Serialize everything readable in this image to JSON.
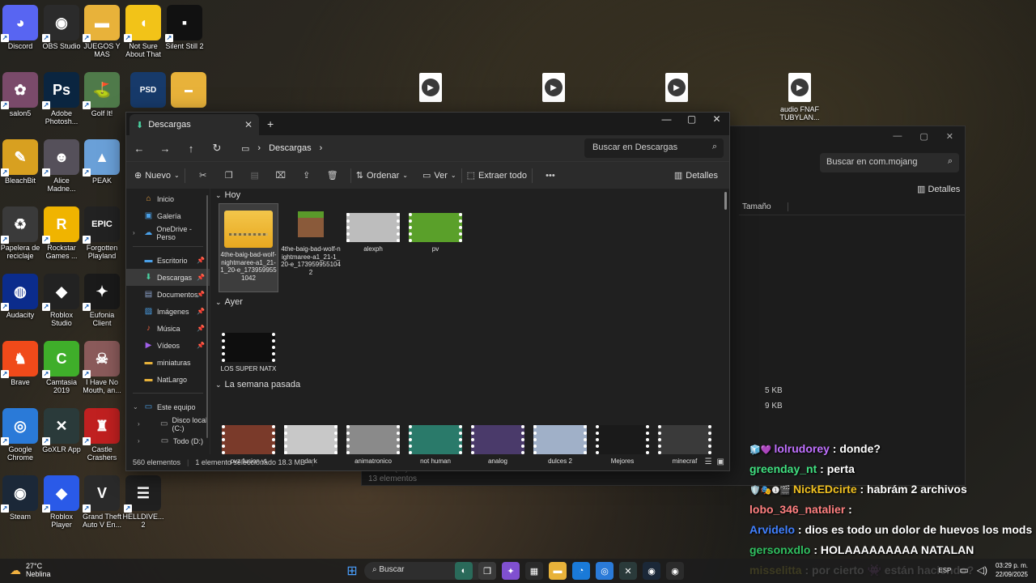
{
  "desktop": {
    "icons": [
      {
        "label": "Discord",
        "color": "#5865F2",
        "glyph": "◕",
        "col": 0,
        "row": 0
      },
      {
        "label": "OBS Studio",
        "color": "#2b2b2b",
        "glyph": "◉",
        "col": 1,
        "row": 0
      },
      {
        "label": "JUEGOS Y MAS",
        "color": "#e8b23a",
        "glyph": "▬",
        "col": 2,
        "row": 0
      },
      {
        "label": "Not Sure About That",
        "color": "#f2c318",
        "glyph": "◖",
        "col": 3,
        "row": 0
      },
      {
        "label": "Silent Still 2",
        "color": "#111111",
        "glyph": "▪",
        "col": 4,
        "row": 0
      },
      {
        "label": "salon5",
        "color": "#7a4a6a",
        "glyph": "✿",
        "col": 0,
        "row": 1
      },
      {
        "label": "Adobe Photosh...",
        "color": "#0a2540",
        "glyph": "Ps",
        "col": 1,
        "row": 1
      },
      {
        "label": "Golf It!",
        "color": "#4f7a4a",
        "glyph": "⛳",
        "col": 2,
        "row": 1
      },
      {
        "label": "BleachBit",
        "color": "#d8a020",
        "glyph": "✎",
        "col": 0,
        "row": 2
      },
      {
        "label": "Alice Madne...",
        "color": "#55505a",
        "glyph": "☻",
        "col": 1,
        "row": 2
      },
      {
        "label": "PEAK",
        "color": "#6aa0d8",
        "glyph": "▲",
        "col": 2,
        "row": 2
      },
      {
        "label": "Papelera de reciclaje",
        "color": "#3a3a3a",
        "glyph": "♻",
        "col": 0,
        "row": 3
      },
      {
        "label": "Rockstar Games ...",
        "color": "#f0b400",
        "glyph": "R",
        "col": 1,
        "row": 3
      },
      {
        "label": "Forgotten Playland",
        "color": "#222222",
        "glyph": "EPIC",
        "col": 2,
        "row": 3
      },
      {
        "label": "Audacity",
        "color": "#0b2c8c",
        "glyph": "◍",
        "col": 0,
        "row": 4
      },
      {
        "label": "Roblox Studio",
        "color": "#222222",
        "glyph": "◆",
        "col": 1,
        "row": 4
      },
      {
        "label": "Eufonia Client",
        "color": "#1a1a1a",
        "glyph": "✦",
        "col": 2,
        "row": 4
      },
      {
        "label": "Brave",
        "color": "#f04a1a",
        "glyph": "♞",
        "col": 0,
        "row": 5
      },
      {
        "label": "Camtasia 2019",
        "color": "#3fae2a",
        "glyph": "C",
        "col": 1,
        "row": 5
      },
      {
        "label": "I Have No Mouth, an...",
        "color": "#8a5a5a",
        "glyph": "☠",
        "col": 2,
        "row": 5
      },
      {
        "label": "Google Chrome",
        "color": "#2a7ad8",
        "glyph": "◎",
        "col": 0,
        "row": 6
      },
      {
        "label": "GoXLR App",
        "color": "#2a3a3a",
        "glyph": "✕",
        "col": 1,
        "row": 6
      },
      {
        "label": "Castle Crashers",
        "color": "#c02020",
        "glyph": "♜",
        "col": 2,
        "row": 6
      },
      {
        "label": "Steam",
        "color": "#1b2838",
        "glyph": "◉",
        "col": 0,
        "row": 7
      },
      {
        "label": "Roblox Player",
        "color": "#2a5ae8",
        "glyph": "◆",
        "col": 1,
        "row": 7
      },
      {
        "label": "Grand Theft Auto V En...",
        "color": "#2a2a2a",
        "glyph": "V",
        "col": 2,
        "row": 7
      },
      {
        "label": "HELLDIVE... 2",
        "color": "#202020",
        "glyph": "☰",
        "col": 3,
        "row": 7
      }
    ],
    "extra_icons": [
      {
        "label": "",
        "color": "#173a6a",
        "glyph": "PSD"
      },
      {
        "label": "",
        "color": "#e8b23a",
        "glyph": "▬"
      }
    ],
    "video_files": [
      {
        "label": ""
      },
      {
        "label": ""
      },
      {
        "label": ""
      },
      {
        "label": "audio FNAF TUBYLAN..."
      }
    ]
  },
  "bg_explorer": {
    "search_placeholder": "Buscar en com.mojang",
    "details_label": "Detalles",
    "column_size": "Tamaño",
    "sizes": [
      "5 KB",
      "9 KB"
    ],
    "sidebar_last": "Todo (D:)",
    "status": "13 elementos"
  },
  "explorer": {
    "tab_title": "Descargas",
    "new_tab": "+",
    "window_controls": [
      "—",
      "▢",
      "✕"
    ],
    "breadcrumb": [
      "Descargas"
    ],
    "search_placeholder": "Buscar en Descargas",
    "toolbar": {
      "new_label": "Nuevo",
      "sort_label": "Ordenar",
      "view_label": "Ver",
      "extract_label": "Extraer todo",
      "more_label": "•••",
      "details_label": "Detalles"
    },
    "sidebar": [
      {
        "label": "Inicio",
        "icon": "home-icon",
        "glyph": "⌂",
        "color": "#e8a040"
      },
      {
        "label": "Galería",
        "icon": "gallery-icon",
        "glyph": "▣",
        "color": "#4aa0e8"
      },
      {
        "label": "OneDrive - Perso",
        "icon": "cloud-icon",
        "glyph": "☁",
        "color": "#4aa0e8",
        "expander": true
      },
      {
        "sep": true
      },
      {
        "label": "Escritorio",
        "icon": "desktop-icon",
        "glyph": "▬",
        "color": "#4aa0e8",
        "pinned": true
      },
      {
        "label": "Descargas",
        "icon": "download-icon",
        "glyph": "⬇",
        "color": "#4ad0a0",
        "pinned": true,
        "selected": true
      },
      {
        "label": "Documentos",
        "icon": "document-icon",
        "glyph": "▤",
        "color": "#8aa0c8",
        "pinned": true
      },
      {
        "label": "Imágenes",
        "icon": "image-icon",
        "glyph": "▨",
        "color": "#4aa0e8",
        "pinned": true
      },
      {
        "label": "Música",
        "icon": "music-icon",
        "glyph": "♪",
        "color": "#e86040",
        "pinned": true
      },
      {
        "label": "Vídeos",
        "icon": "video-icon",
        "glyph": "▶",
        "color": "#a060e8",
        "pinned": true
      },
      {
        "label": "miniaturas",
        "icon": "folder-icon",
        "glyph": "▬",
        "color": "#e8b23a"
      },
      {
        "label": "NatLargo",
        "icon": "folder-icon",
        "glyph": "▬",
        "color": "#e8b23a"
      },
      {
        "sep": true
      },
      {
        "label": "Este equipo",
        "icon": "pc-icon",
        "glyph": "▭",
        "color": "#4aa0e8",
        "expanded": true
      },
      {
        "label": "Disco local (C:)",
        "icon": "drive-icon",
        "glyph": "▭",
        "color": "#aaaaaa",
        "expander": true,
        "indent": true
      },
      {
        "label": "Todo (D:)",
        "icon": "drive-icon",
        "glyph": "▭",
        "color": "#aaaaaa",
        "expander": true,
        "indent": true
      }
    ],
    "groups": [
      {
        "title": "Hoy",
        "files": [
          {
            "label": "4the-baig-bad-wolf-nightmaree-a1_21-1_20-e_1739599551042",
            "kind": "zip",
            "selected": true
          },
          {
            "label": "4the-baig-bad-wolf-nightmaree-a1_21-1_20-e_1739599551042",
            "kind": "mc"
          },
          {
            "label": "alexph",
            "kind": "video",
            "tint": "#bdbdbd"
          },
          {
            "label": "pv",
            "kind": "video",
            "tint": "#5aa02a"
          }
        ]
      },
      {
        "title": "Ayer",
        "files": [
          {
            "label": "LOS SUPER NATX",
            "kind": "video",
            "tint": "#0e0e0e"
          }
        ]
      },
      {
        "title": "La semana pasada",
        "files": [
          {
            "label": "pvz fusion yt",
            "kind": "video",
            "tint": "#7a3a2a"
          },
          {
            "label": "dark",
            "kind": "video",
            "tint": "#c8c8c8"
          },
          {
            "label": "animatronico",
            "kind": "video",
            "tint": "#8a8a8a"
          },
          {
            "label": "not human",
            "kind": "video",
            "tint": "#2a7a6a"
          },
          {
            "label": "analog",
            "kind": "video",
            "tint": "#4a3a6a"
          },
          {
            "label": "dulces 2",
            "kind": "video",
            "tint": "#a0b0c8"
          },
          {
            "label": "Mejores",
            "kind": "video",
            "tint": "#1a1a1a"
          },
          {
            "label": "minecraf",
            "kind": "video",
            "tint": "#3a3a3a"
          }
        ]
      }
    ],
    "status": {
      "count": "560 elementos",
      "selection": "1 elemento seleccionado  18.3 MB"
    }
  },
  "chat": [
    {
      "user": "lolrudorey",
      "color": "#c070ff",
      "badges": "🧊💜 ",
      "message": ": donde?"
    },
    {
      "user": "greenday_nt",
      "color": "#40e080",
      "badges": "",
      "message": ": perta"
    },
    {
      "user": "NickEDcirte",
      "color": "#f0c020",
      "badges": "🛡️🎭❶🎬 ",
      "message": ": habrám 2 archivos"
    },
    {
      "user": "lobo_346_natalier",
      "color": "#ff8080",
      "badges": "",
      "message": ":"
    },
    {
      "user": "Arvidelo",
      "color": "#4080ff",
      "badges": "",
      "message": ": dios es todo un dolor de huevos los mods"
    },
    {
      "user": "gersonxdlo",
      "color": "#30c060",
      "badges": "",
      "message": ": HOLAAAAAAAAA NATALAN"
    },
    {
      "user": "misselitta",
      "color": "#f0e040",
      "badges": "",
      "message": ": por cierto 👾 están haciendo?"
    }
  ],
  "taskbar": {
    "temp": "27°C",
    "weather": "Neblina",
    "search": "Buscar",
    "lang": "ESP",
    "time": "03:29 p. m.",
    "date": "22/09/2025"
  }
}
